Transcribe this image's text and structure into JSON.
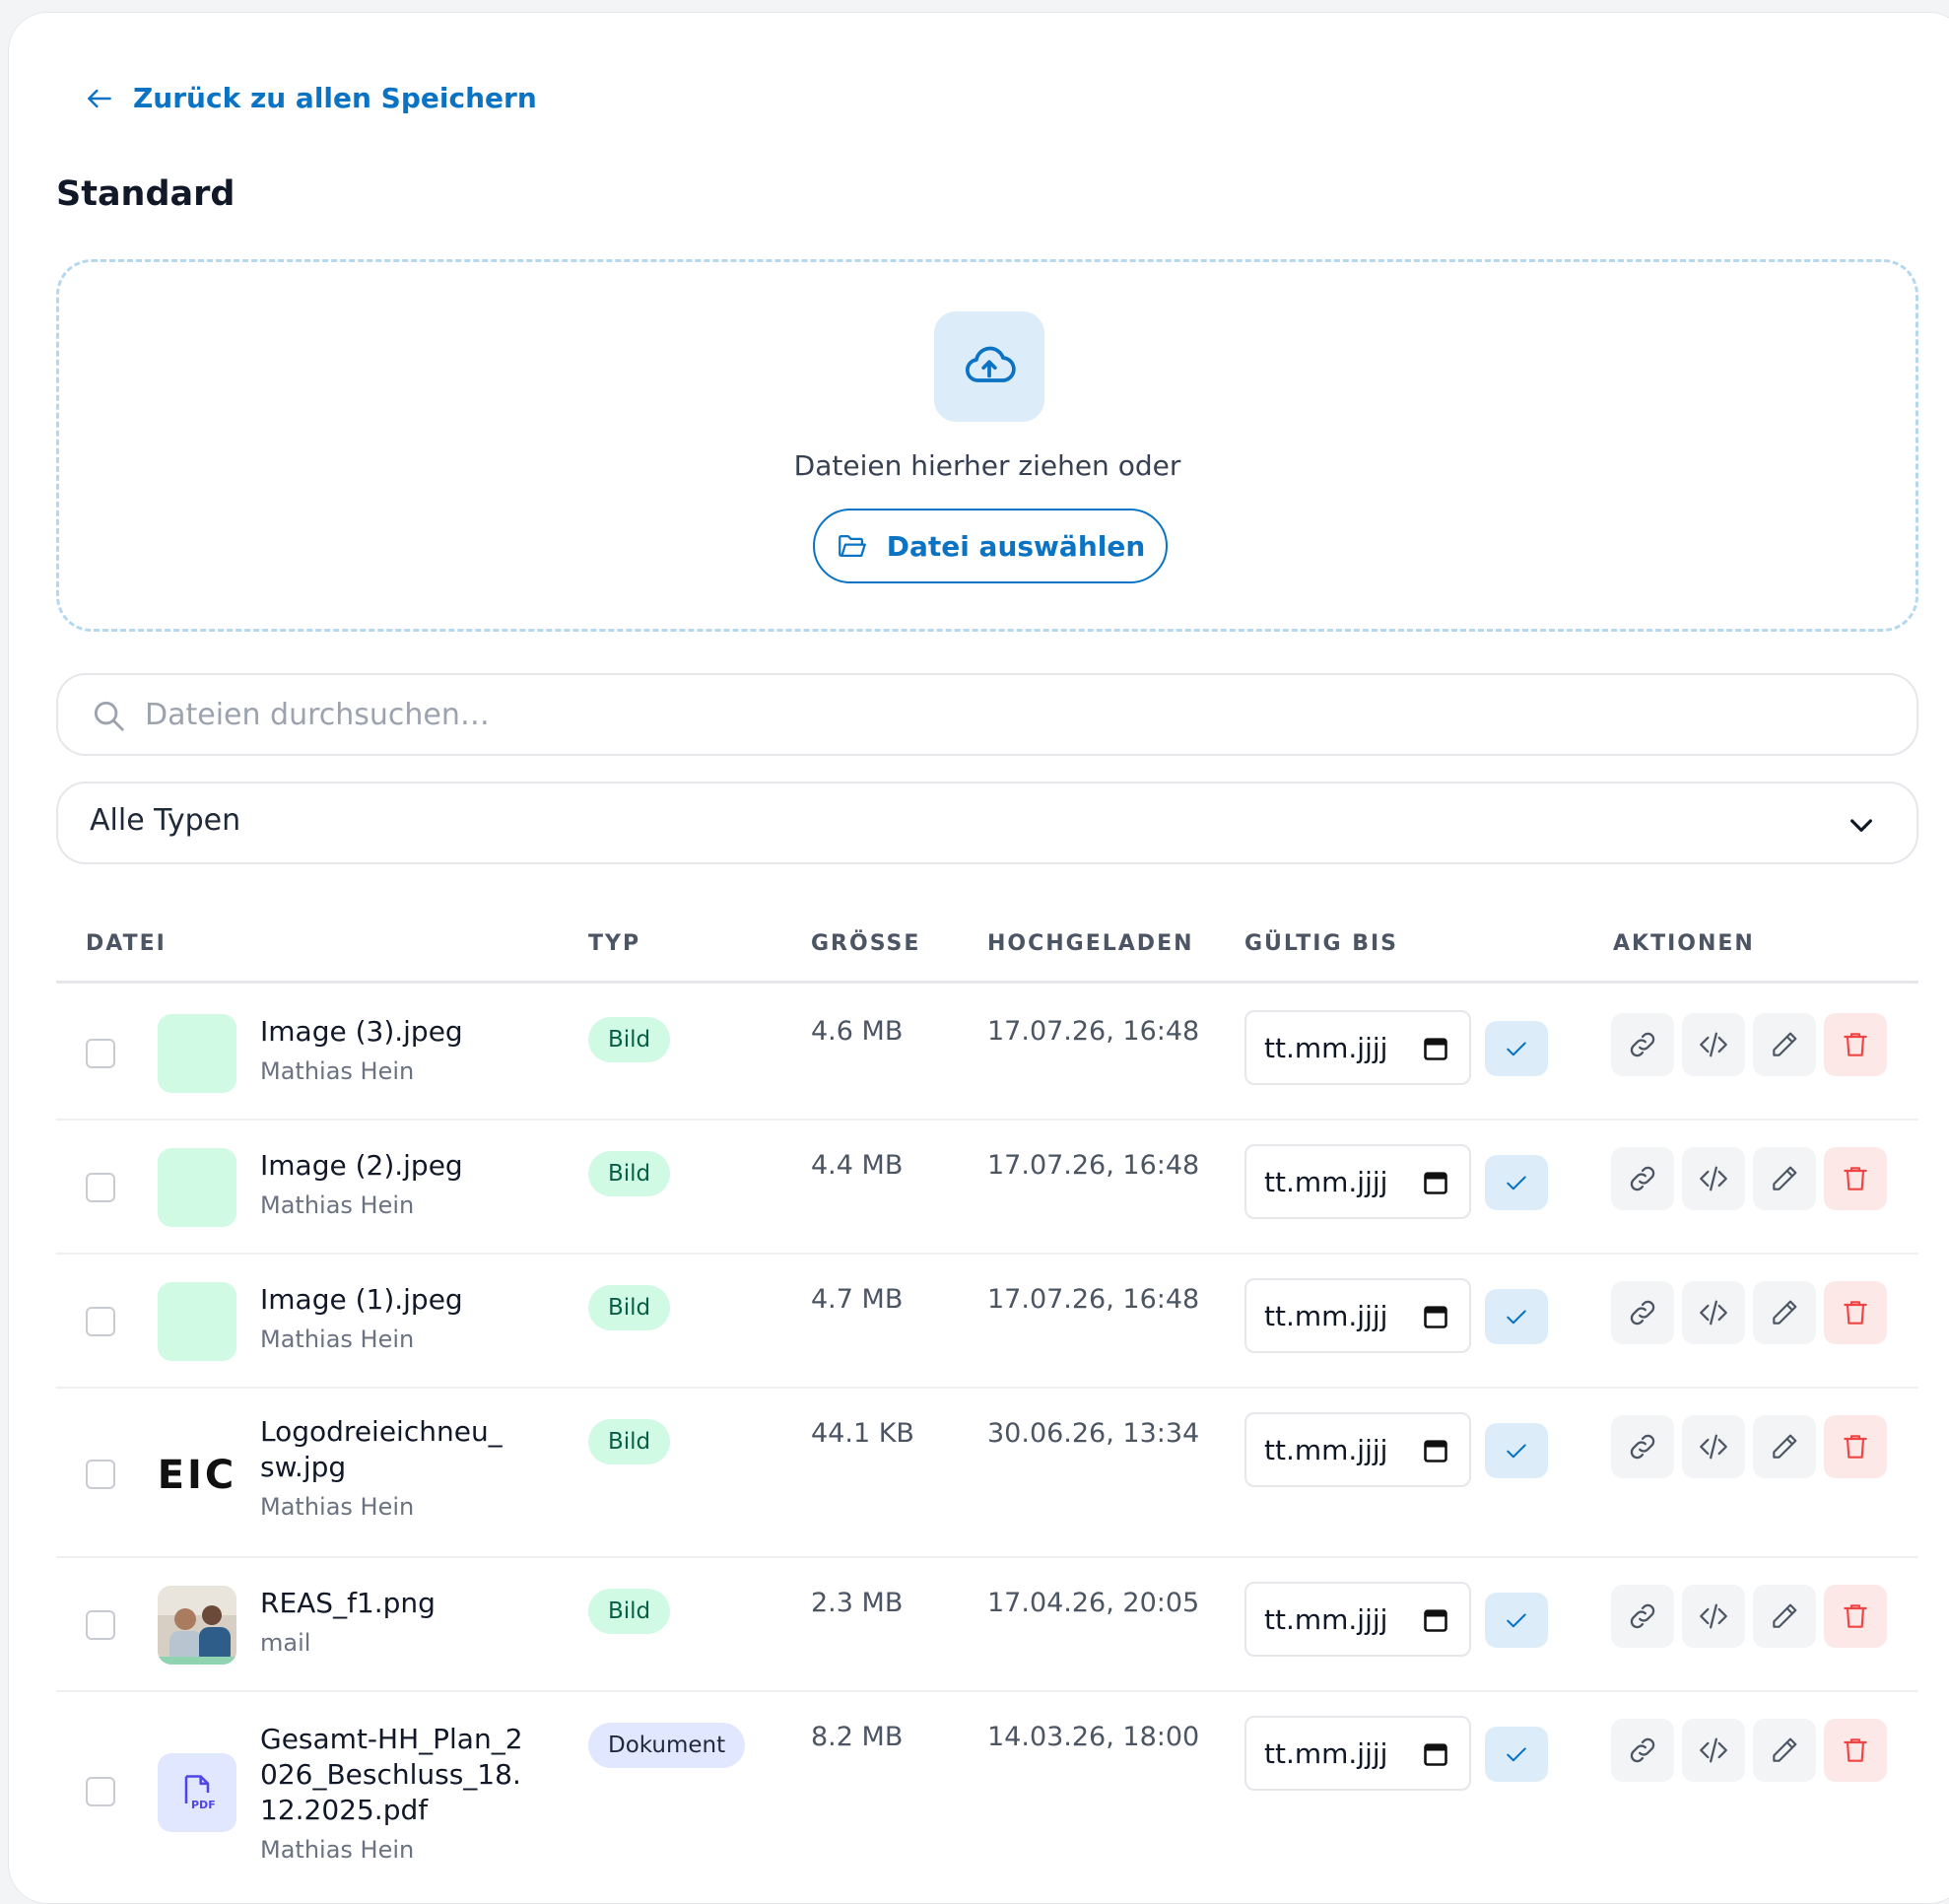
{
  "back_link": {
    "label": "Zurück zu allen Speichern",
    "icon": "arrow-left-icon"
  },
  "page_title": "Standard",
  "dropzone": {
    "icon": "cloud-upload-icon",
    "text": "Dateien hierher ziehen oder",
    "button_label": "Datei auswählen",
    "button_icon": "folder-open-icon"
  },
  "search": {
    "placeholder": "Dateien durchsuchen…",
    "value": "",
    "icon": "search-icon"
  },
  "type_filter": {
    "selected": "Alle Typen",
    "icon": "chevron-down-icon"
  },
  "table": {
    "columns": {
      "file": "DATEI",
      "type": "TYP",
      "size": "GRÖSSE",
      "uploaded": "HOCHGELADEN",
      "valid_until": "GÜLTIG BIS",
      "actions": "AKTIONEN"
    },
    "rows": [
      {
        "name": "Image (3).jpeg",
        "owner": "Mathias Hein",
        "type": "Bild",
        "size": "4.6 MB",
        "uploaded": "17.07.26, 16:48",
        "valid_until": "tt.mm.jjjj"
      },
      {
        "name": "Image (2).jpeg",
        "owner": "Mathias Hein",
        "type": "Bild",
        "size": "4.4 MB",
        "uploaded": "17.07.26, 16:48",
        "valid_until": "tt.mm.jjjj"
      },
      {
        "name": "Image (1).jpeg",
        "owner": "Mathias Hein",
        "type": "Bild",
        "size": "4.7 MB",
        "uploaded": "17.07.26, 16:48",
        "valid_until": "tt.mm.jjjj"
      },
      {
        "name": "Logodreieichneu_sw.jpg",
        "owner": "Mathias Hein",
        "type": "Bild",
        "size": "44.1 KB",
        "uploaded": "30.06.26, 13:34",
        "valid_until": "tt.mm.jjjj",
        "thumb_text": "EIC"
      },
      {
        "name": "REAS_f1.png",
        "owner": "mail",
        "type": "Bild",
        "size": "2.3 MB",
        "uploaded": "17.04.26, 20:05",
        "valid_until": "tt.mm.jjjj"
      },
      {
        "name": "Gesamt-HH_Plan_2026_Beschluss_18.12.2025.pdf",
        "owner": "Mathias Hein",
        "type": "Dokument",
        "size": "8.2 MB",
        "uploaded": "14.03.26, 18:00",
        "valid_until": "tt.mm.jjjj",
        "thumb_text": "PDF"
      }
    ],
    "action_icons": [
      "link-icon",
      "code-icon",
      "pencil-icon",
      "trash-icon"
    ]
  },
  "colors": {
    "accent": "#0a73c4",
    "badge_image_bg": "#d1fae5",
    "badge_document_bg": "#e0e7ff",
    "delete": "#ef4444"
  }
}
